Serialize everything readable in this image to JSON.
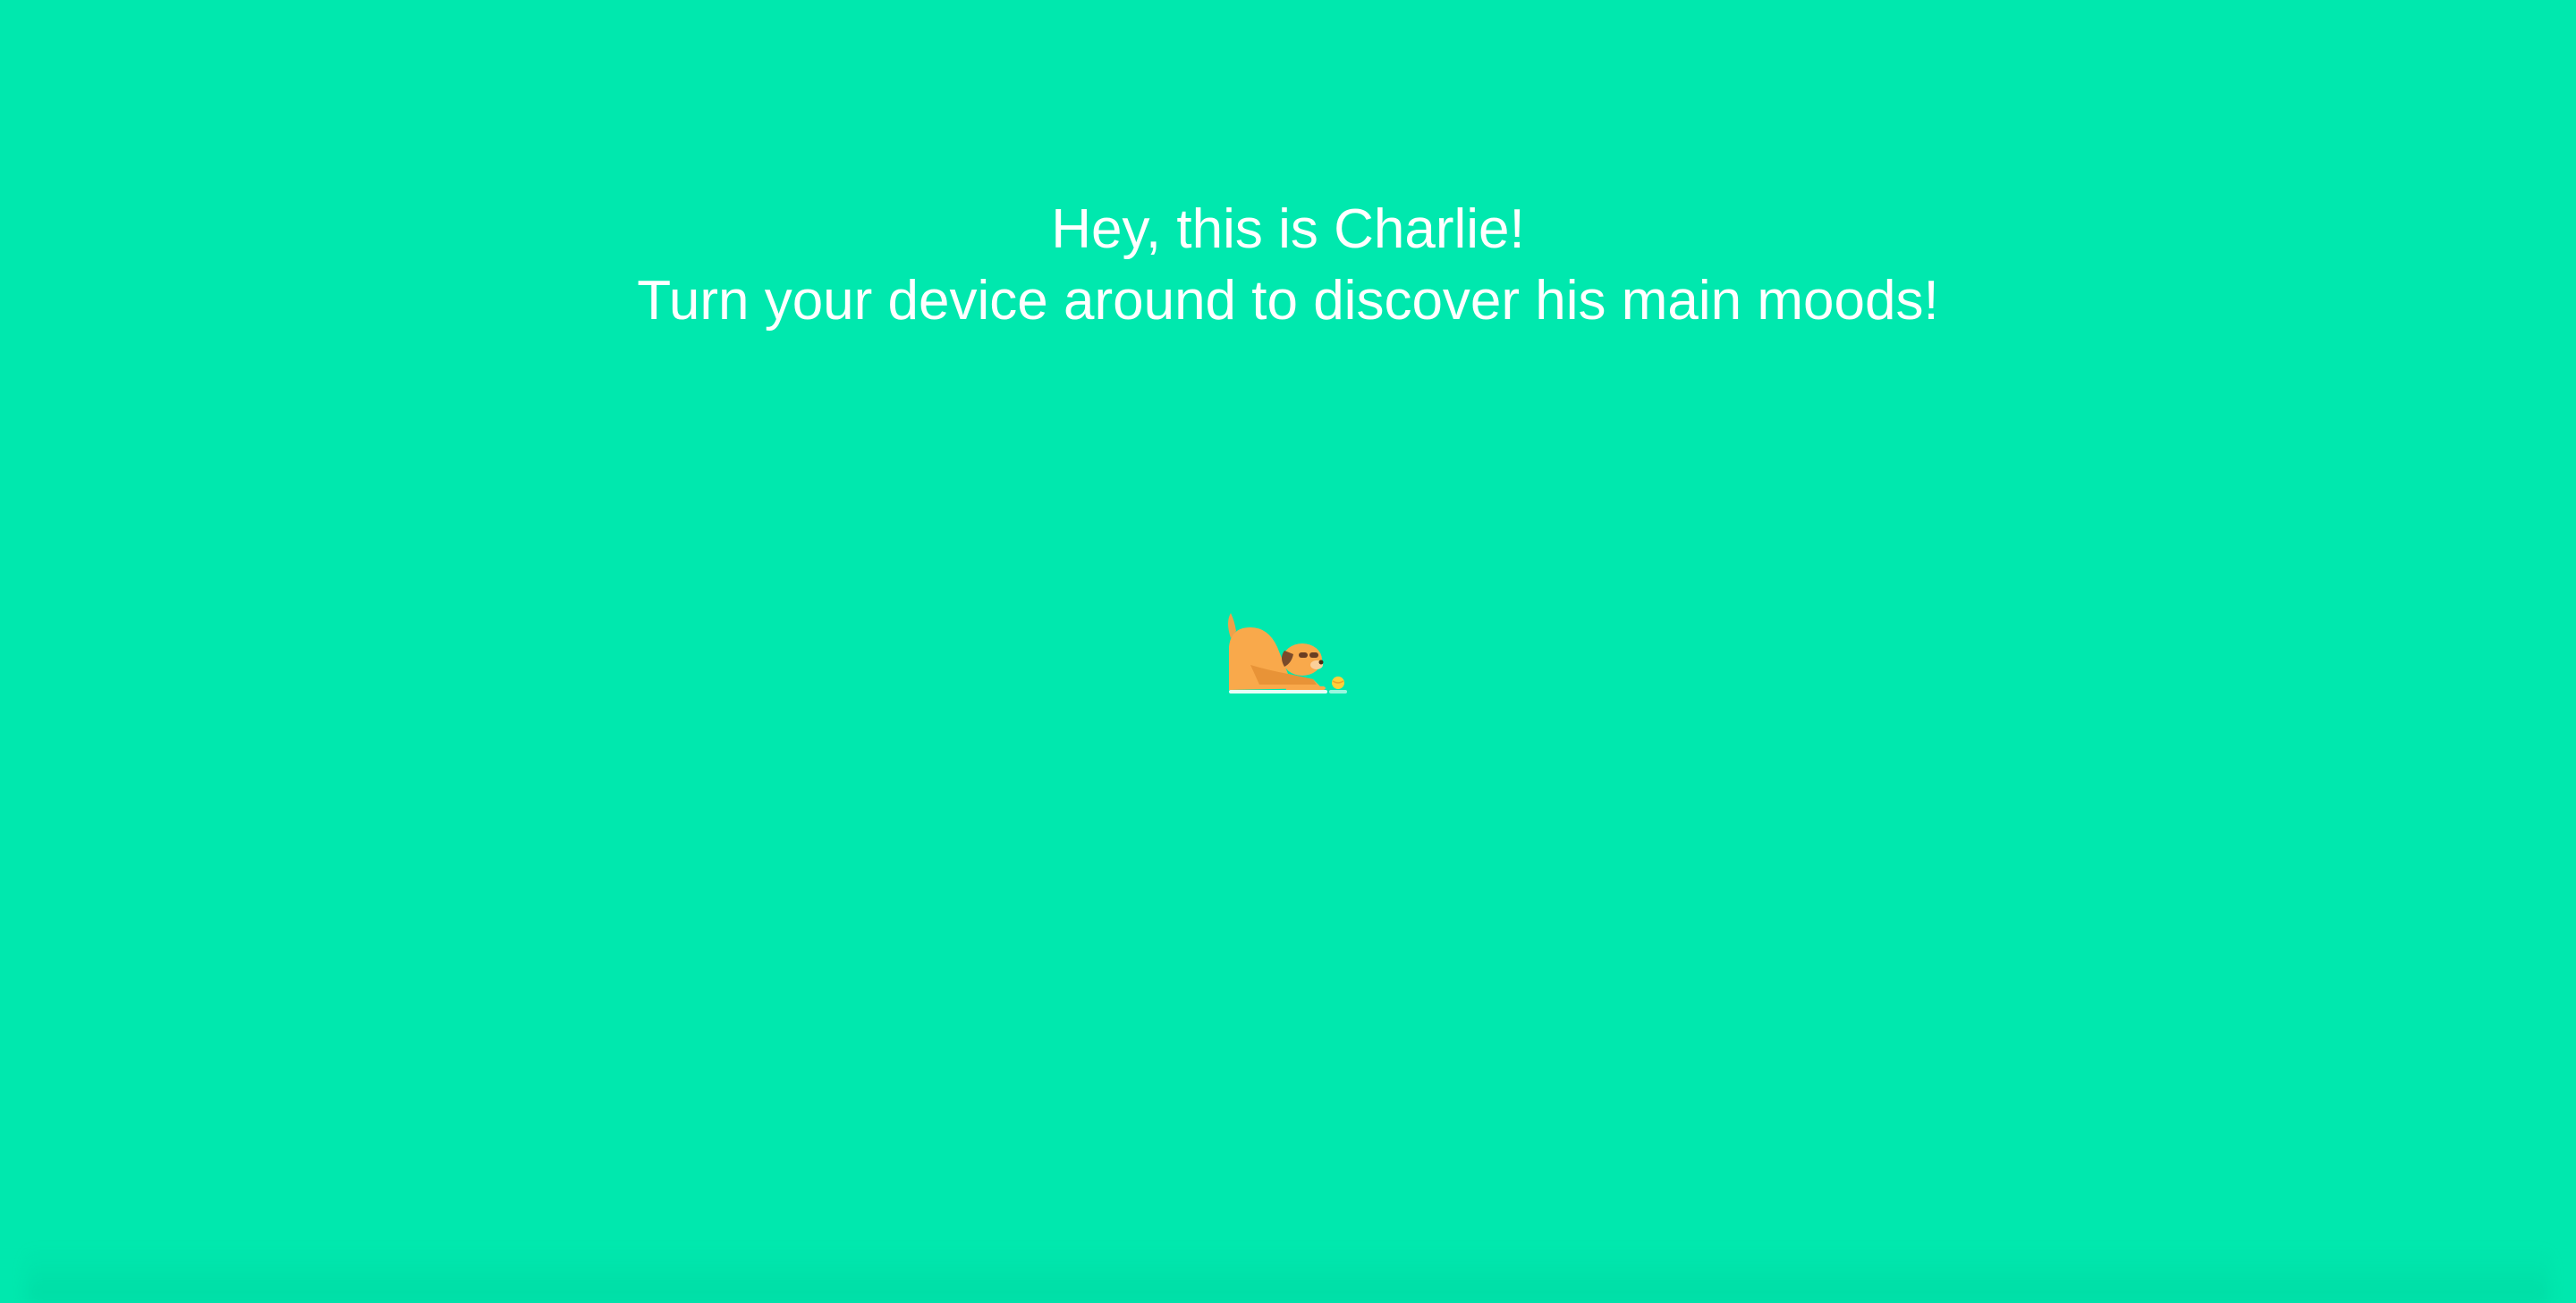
{
  "page": {
    "background_color": "#00e8ae",
    "text_color": "#ffffff"
  },
  "headline": {
    "line1": "Hey, this is Charlie!",
    "line2": "Turn your device around to discover his main moods!"
  },
  "illustration": {
    "icon": "dog-playing-with-ball-icon",
    "colors": {
      "dog_body": "#f9a94b",
      "dog_ear": "#7a4a2a",
      "ball": "#ffcf3a",
      "ground": "#ffffff"
    }
  }
}
